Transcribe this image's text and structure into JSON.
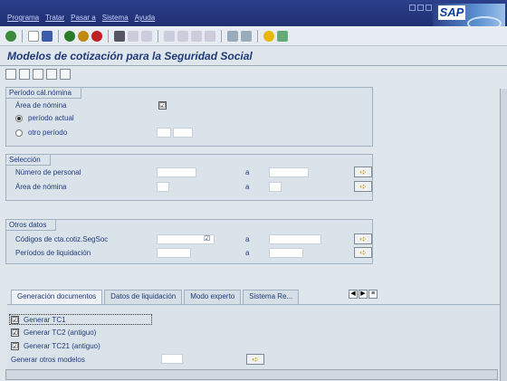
{
  "menu": [
    "Programa",
    "Tratar",
    "Pasar a",
    "Sistema",
    "Ayuda"
  ],
  "logo_text": "SAP",
  "title": "Modelos de cotización para la Seguridad Social",
  "periodo": {
    "header": "Período cál.nómina",
    "area_label": "Área de nómina",
    "area_checked": "☑",
    "actual_label": "período actual",
    "otro_label": "otro período"
  },
  "seleccion": {
    "header": "Selección",
    "rows": [
      {
        "label": "Número de personal",
        "a": "a"
      },
      {
        "label": "Área de nómina",
        "a": "a"
      }
    ]
  },
  "otros": {
    "header": "Otros datos",
    "rows": [
      {
        "label": "Códigos de cta.cotiz.SegSoc",
        "a": "a",
        "check": "☑"
      },
      {
        "label": "Períodos de liquidación",
        "a": "a"
      }
    ]
  },
  "tabs": [
    "Generación documentos",
    "Datos de liquidación",
    "Modo experto",
    "Sistema Re..."
  ],
  "generation": {
    "items": [
      {
        "label": "Generar TC1",
        "check": "☑"
      },
      {
        "label": "Generar TC2 (antiguo)",
        "check": "☑"
      },
      {
        "label": "Generar TC21 (antiguo)",
        "check": "☑"
      }
    ],
    "otros_label": "Generar otros modelos"
  }
}
